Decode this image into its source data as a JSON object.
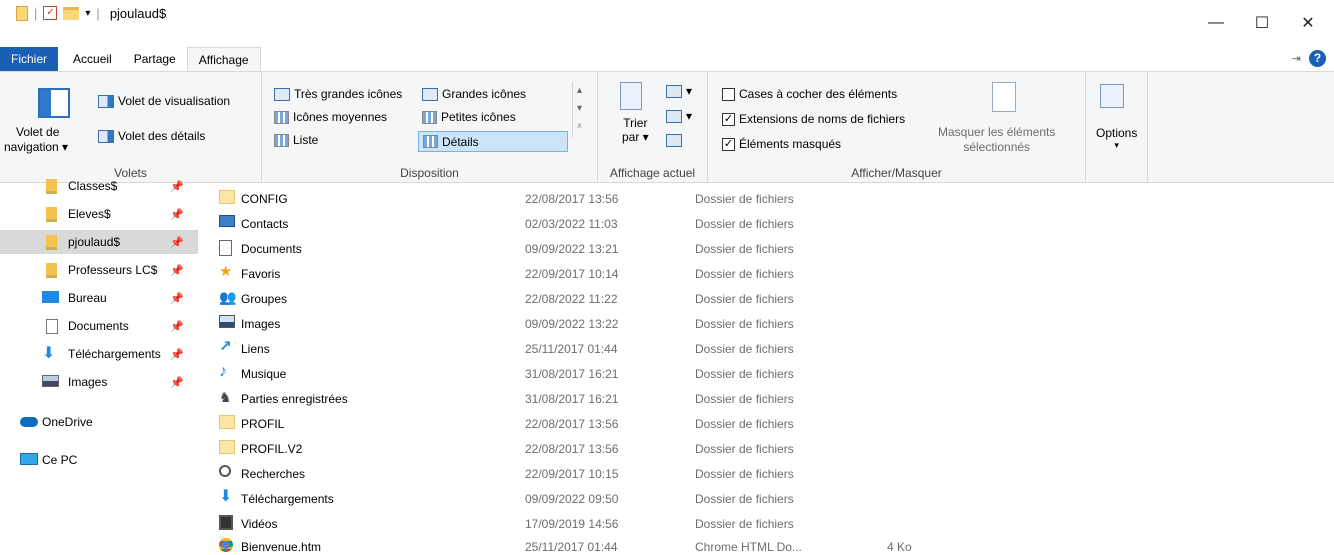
{
  "window": {
    "title": "pjoulaud$",
    "controls": [
      "—",
      "☐",
      "✕"
    ]
  },
  "tabs": [
    {
      "label": "Fichier"
    },
    {
      "label": "Accueil"
    },
    {
      "label": "Partage"
    },
    {
      "label": "Affichage"
    }
  ],
  "ribbon": {
    "volets": {
      "nav_label_1": "Volet de",
      "nav_label_2": "navigation",
      "preview": "Volet de visualisation",
      "details": "Volet des détails",
      "group": "Volets"
    },
    "disposition": {
      "items": [
        "Très grandes icônes",
        "Grandes icônes",
        "Icônes moyennes",
        "Petites icônes",
        "Liste",
        "Détails"
      ],
      "selected": "Détails",
      "group": "Disposition"
    },
    "affichage_actuel": {
      "sort_1": "Trier",
      "sort_2": "par",
      "group": "Affichage actuel"
    },
    "afficher_masquer": {
      "checkboxes": [
        {
          "label": "Cases à cocher des éléments",
          "checked": false
        },
        {
          "label": "Extensions de noms de fichiers",
          "checked": true
        },
        {
          "label": "Éléments masqués",
          "checked": true
        }
      ],
      "hide_1": "Masquer les éléments",
      "hide_2": "sélectionnés",
      "group": "Afficher/Masquer"
    },
    "options": {
      "label": "Options"
    }
  },
  "nav": {
    "items": [
      {
        "label": "Classes$",
        "icon": "folder-pin",
        "pinned": true
      },
      {
        "label": "Eleves$",
        "icon": "folder-pin",
        "pinned": true
      },
      {
        "label": "pjoulaud$",
        "icon": "folder-pin",
        "pinned": true,
        "selected": true
      },
      {
        "label": "Professeurs LC$",
        "icon": "folder-pin",
        "pinned": true
      },
      {
        "label": "Bureau",
        "icon": "desktop",
        "pinned": true
      },
      {
        "label": "Documents",
        "icon": "documents",
        "pinned": true
      },
      {
        "label": "Téléchargements",
        "icon": "download",
        "pinned": true
      },
      {
        "label": "Images",
        "icon": "images",
        "pinned": true
      },
      {
        "label": "OneDrive",
        "icon": "cloud"
      },
      {
        "label": "Ce PC",
        "icon": "pc"
      }
    ]
  },
  "files": [
    {
      "name": "CONFIG",
      "date": "22/08/2017 13:56",
      "type": "Dossier de fichiers",
      "size": "",
      "icon": "folder"
    },
    {
      "name": "Contacts",
      "date": "02/03/2022 11:03",
      "type": "Dossier de fichiers",
      "size": "",
      "icon": "contact"
    },
    {
      "name": "Documents",
      "date": "09/09/2022 13:21",
      "type": "Dossier de fichiers",
      "size": "",
      "icon": "doc"
    },
    {
      "name": "Favoris",
      "date": "22/09/2017 10:14",
      "type": "Dossier de fichiers",
      "size": "",
      "icon": "star"
    },
    {
      "name": "Groupes",
      "date": "22/08/2022 11:22",
      "type": "Dossier de fichiers",
      "size": "",
      "icon": "group"
    },
    {
      "name": "Images",
      "date": "09/09/2022 13:22",
      "type": "Dossier de fichiers",
      "size": "",
      "icon": "image"
    },
    {
      "name": "Liens",
      "date": "25/11/2017 01:44",
      "type": "Dossier de fichiers",
      "size": "",
      "icon": "link"
    },
    {
      "name": "Musique",
      "date": "31/08/2017 16:21",
      "type": "Dossier de fichiers",
      "size": "",
      "icon": "music"
    },
    {
      "name": "Parties enregistrées",
      "date": "31/08/2017 16:21",
      "type": "Dossier de fichiers",
      "size": "",
      "icon": "game"
    },
    {
      "name": "PROFIL",
      "date": "22/08/2017 13:56",
      "type": "Dossier de fichiers",
      "size": "",
      "icon": "folder"
    },
    {
      "name": "PROFIL.V2",
      "date": "22/08/2017 13:56",
      "type": "Dossier de fichiers",
      "size": "",
      "icon": "folder"
    },
    {
      "name": "Recherches",
      "date": "22/09/2017 10:15",
      "type": "Dossier de fichiers",
      "size": "",
      "icon": "search"
    },
    {
      "name": "Téléchargements",
      "date": "09/09/2022 09:50",
      "type": "Dossier de fichiers",
      "size": "",
      "icon": "download"
    },
    {
      "name": "Vidéos",
      "date": "17/09/2019 14:56",
      "type": "Dossier de fichiers",
      "size": "",
      "icon": "video"
    },
    {
      "name": "Bienvenue.htm",
      "date": "25/11/2017 01:44",
      "type": "Chrome HTML Do...",
      "size": "4 Ko",
      "icon": "chrome"
    }
  ]
}
